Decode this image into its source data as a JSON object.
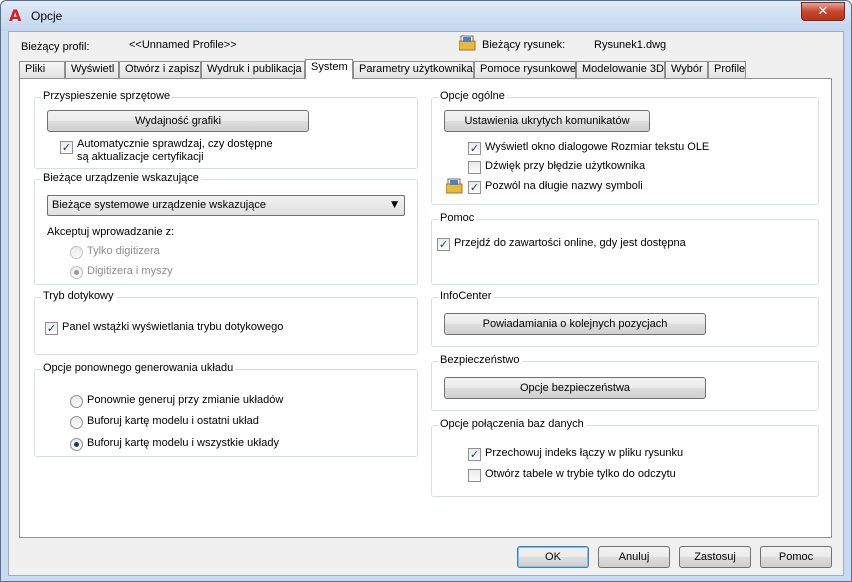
{
  "window": {
    "title": "Opcje",
    "close_glyph": "✕"
  },
  "header": {
    "profile_label": "Bieżący profil:",
    "profile_value": "<<Unnamed Profile>>",
    "drawing_label": "Bieżący rysunek:",
    "drawing_value": "Rysunek1.dwg"
  },
  "tabs": [
    {
      "label": "Pliki"
    },
    {
      "label": "Wyświetl"
    },
    {
      "label": "Otwórz i zapisz"
    },
    {
      "label": "Wydruk i publikacja"
    },
    {
      "label": "System",
      "active": true
    },
    {
      "label": "Parametry użytkownika"
    },
    {
      "label": "Pomoce rysunkowe"
    },
    {
      "label": "Modelowanie 3D"
    },
    {
      "label": "Wybór"
    },
    {
      "label": "Profile"
    }
  ],
  "hardware": {
    "title": "Przyspieszenie sprzętowe",
    "button": "Wydajność grafiki",
    "check_label_1": "Automatycznie sprawdzaj, czy dostępne",
    "check_label_2": "są aktualizacje certyfikacji",
    "checked": true
  },
  "pointing": {
    "title": "Bieżące urządzenie wskazujące",
    "select_value": "Bieżące systemowe urządzenie wskazujące",
    "accept_label": "Akceptuj wprowadzanie z:",
    "radio_1": "Tylko digitizera",
    "radio_2": "Digitizera i myszy",
    "selected": 2
  },
  "touch": {
    "title": "Tryb dotykowy",
    "check_label": "Panel wstążki wyświetlania trybu dotykowego",
    "checked": true
  },
  "regen": {
    "title": "Opcje ponownego generowania układu",
    "radio_1": "Ponownie generuj przy zmianie układów",
    "radio_2": "Buforuj kartę modelu i ostatni układ",
    "radio_3": "Buforuj kartę modelu i wszystkie układy",
    "selected": 3
  },
  "general": {
    "title": "Opcje ogólne",
    "button": "Ustawienia ukrytych komunikatów",
    "check_1": "Wyświetl okno dialogowe Rozmiar tekstu OLE",
    "check_2": "Dźwięk przy błędzie użytkownika",
    "check_3": "Pozwól na długie nazwy symboli",
    "checked": [
      true,
      false,
      true
    ]
  },
  "help": {
    "title": "Pomoc",
    "check_label": "Przejdź do zawartości online, gdy jest dostępna",
    "checked": true
  },
  "infocenter": {
    "title": "InfoCenter",
    "button": "Powiadamiania o kolejnych pozycjach"
  },
  "security": {
    "title": "Bezpieczeństwo",
    "button": "Opcje bezpieczeństwa"
  },
  "db": {
    "title": "Opcje połączenia baz danych",
    "check_1": "Przechowuj indeks łączy w pliku rysunku",
    "check_2": "Otwórz tabele w trybie tylko do odczytu",
    "checked": [
      true,
      false
    ]
  },
  "footer": {
    "ok": "OK",
    "cancel": "Anuluj",
    "apply": "Zastosuj",
    "help": "Pomoc"
  },
  "icons": {
    "app": "autocad-logo-icon",
    "drawing": "drawing-file-icon",
    "close": "close-icon"
  },
  "colors": {
    "app_logo": "#d42020",
    "close_button": "#c6462d",
    "check_mark": "#1c3d72"
  }
}
